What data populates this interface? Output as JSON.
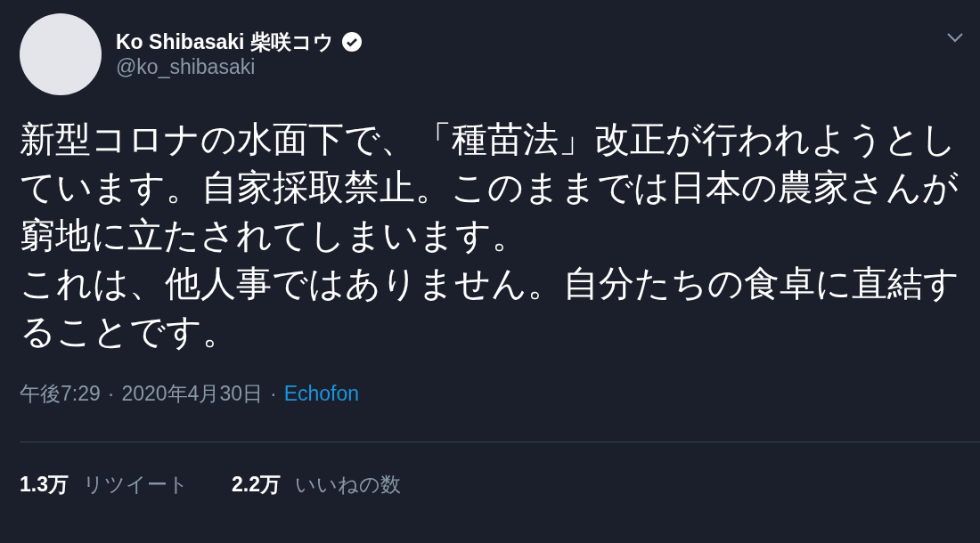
{
  "author": {
    "name": "Ko Shibasaki 柴咲コウ",
    "verified": true,
    "handle": "@ko_shibasaki"
  },
  "body": [
    "新型コロナの水面下で、「種苗法」改正が行われようとしています。自家採取禁止。このままでは日本の農家さんが窮地に立たされてしまいます。",
    "これは、他人事ではありません。自分たちの食卓に直結することです。"
  ],
  "meta": {
    "time": "午後7:29",
    "separator_1": "·",
    "date": "2020年4月30日",
    "separator_2": "·",
    "source": "Echofon"
  },
  "stats": [
    {
      "count": "1.3万",
      "label": "リツイート"
    },
    {
      "count": "2.2万",
      "label": "いいねの数"
    }
  ]
}
